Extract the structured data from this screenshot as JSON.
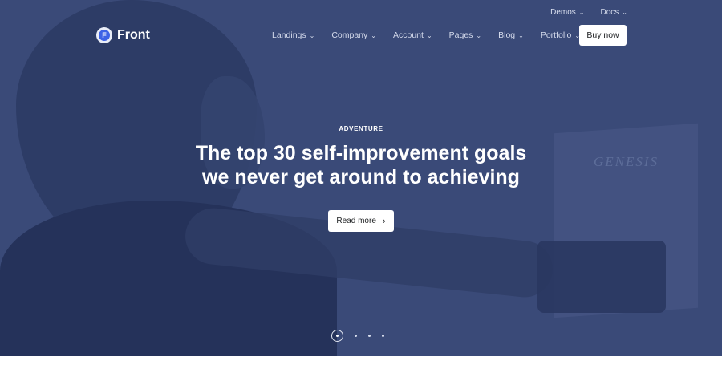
{
  "brand": {
    "name": "Front",
    "logo_letter": "F"
  },
  "topbar": [
    {
      "label": "Demos"
    },
    {
      "label": "Docs"
    }
  ],
  "nav": [
    {
      "label": "Landings"
    },
    {
      "label": "Company"
    },
    {
      "label": "Account"
    },
    {
      "label": "Pages"
    },
    {
      "label": "Blog"
    },
    {
      "label": "Portfolio"
    }
  ],
  "cta": {
    "buy_label": "Buy now"
  },
  "hero": {
    "eyebrow": "ADVENTURE",
    "headline_line1": "The top 30 self-improvement goals",
    "headline_line2": "we never get around to achieving",
    "button_label": "Read more",
    "book_title": "GENESIS"
  },
  "carousel": {
    "count": 4,
    "active_index": 0
  },
  "colors": {
    "hero_overlay": "#3a4a78",
    "button_bg": "#ffffff",
    "brand_accent": "#3d63e6"
  },
  "icons": {
    "chevron": "chevron-down-icon",
    "arrow": "chevron-right-icon"
  }
}
